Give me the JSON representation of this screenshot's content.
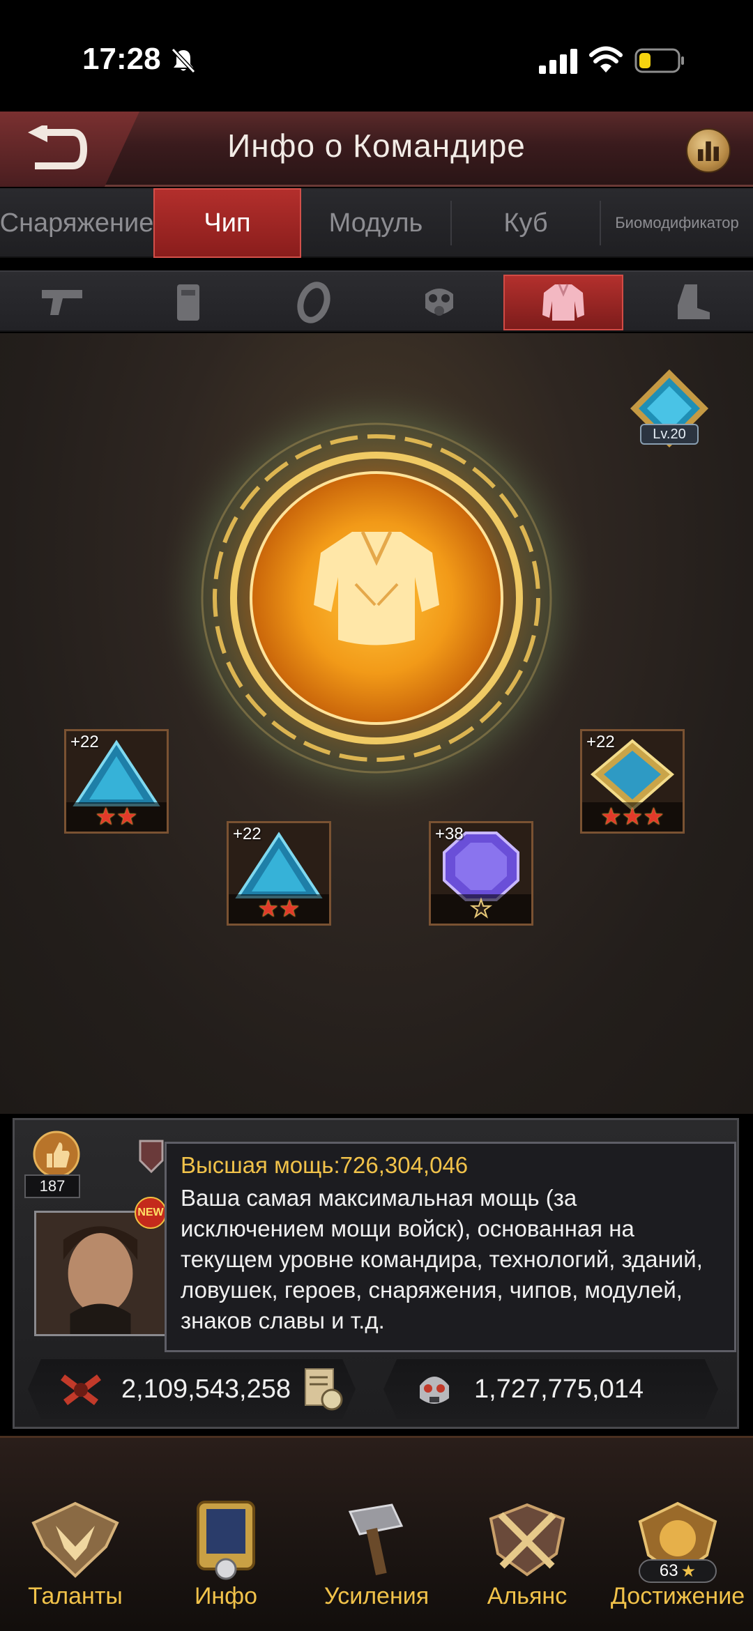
{
  "status_bar": {
    "time": "17:28",
    "icons": [
      "bell-slash-icon",
      "signal-icon",
      "wifi-icon",
      "battery-low-icon"
    ]
  },
  "header": {
    "title": "Инфо о Командире",
    "back_icon": "back-arrow-icon",
    "stats_icon": "bar-chart-icon"
  },
  "main_tabs": [
    {
      "label": "Снаряжение",
      "active": false
    },
    {
      "label": "Чип",
      "active": true
    },
    {
      "label": "Модуль",
      "active": false
    },
    {
      "label": "Куб",
      "active": false
    },
    {
      "label": "Биомодификатор",
      "active": false
    }
  ],
  "sub_tabs": [
    {
      "icon": "pistol-icon",
      "active": false
    },
    {
      "icon": "vest-icon",
      "active": false
    },
    {
      "icon": "ring-icon",
      "active": false
    },
    {
      "icon": "gas-mask-icon",
      "active": false
    },
    {
      "icon": "jacket-icon",
      "active": true
    },
    {
      "icon": "boot-icon",
      "active": false
    }
  ],
  "level_badge": "Lv.20",
  "chips": [
    {
      "level": "+22",
      "stars": 2,
      "filled_stars": 2
    },
    {
      "level": "+22",
      "stars": 2,
      "filled_stars": 2
    },
    {
      "level": "+38",
      "stars": 1,
      "filled_stars": 0
    },
    {
      "level": "+22",
      "stars": 3,
      "filled_stars": 3
    }
  ],
  "profile": {
    "likes": "187",
    "new_badge": "NEW"
  },
  "tooltip": {
    "title": "Высшая мощь:726,304,046",
    "body": "Ваша самая максимальная мощь (за исключением мощи войск), основанная на текущем уровне командира, технологий, зданий, ловушек, героев, снаряжения, чипов, модулей, знаков славы и т.д."
  },
  "stats": {
    "power": "2,109,543,258",
    "kills": "1,727,775,014"
  },
  "bottom_nav": [
    {
      "label": "Таланты",
      "icon": "eagle-emblem-icon"
    },
    {
      "label": "Инфо",
      "icon": "info-shield-icon"
    },
    {
      "label": "Усиления",
      "icon": "hammer-icon"
    },
    {
      "label": "Альянс",
      "icon": "crossed-swords-icon"
    },
    {
      "label": "Достижение",
      "icon": "lion-emblem-icon",
      "count": "63"
    }
  ],
  "colors": {
    "accent_red": "#b32f2c",
    "gold_text": "#f1c24a",
    "orb_orange": "#f2a21c"
  }
}
